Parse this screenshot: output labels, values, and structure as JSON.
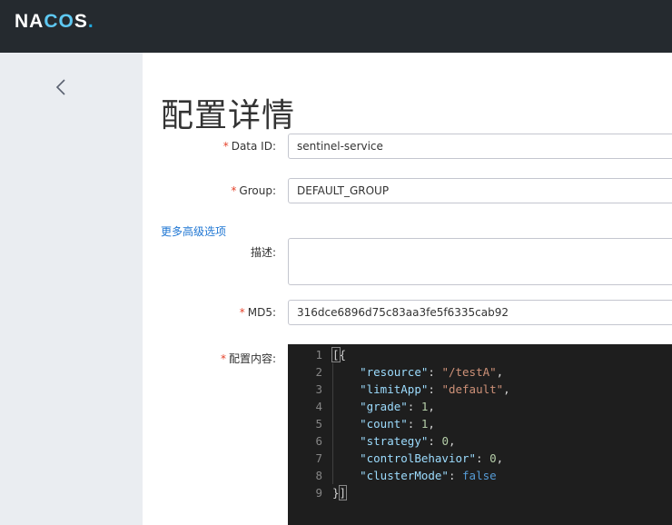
{
  "header": {
    "logo_text": "NACOS.",
    "accent": "#5ec8f2"
  },
  "sidebar": {
    "back_icon": "chevron-left-icon"
  },
  "page": {
    "title": "配置详情"
  },
  "form": {
    "data_id": {
      "required_mark": "*",
      "label": "Data ID:",
      "value": "sentinel-service"
    },
    "group": {
      "required_mark": "*",
      "label": "Group:",
      "value": "DEFAULT_GROUP"
    },
    "advanced_link": "更多高级选项",
    "description": {
      "label": "描述:",
      "value": ""
    },
    "md5": {
      "required_mark": "*",
      "label": "MD5:",
      "value": "316dce6896d75c83aa3fe5f6335cab92"
    },
    "content": {
      "required_mark": "*",
      "label": "配置内容:"
    }
  },
  "editor": {
    "line_numbers": [
      "1",
      "2",
      "3",
      "4",
      "5",
      "6",
      "7",
      "8",
      "9"
    ],
    "lines": [
      "[{",
      "    \"resource\": \"/testA\",",
      "    \"limitApp\": \"default\",",
      "    \"grade\": 1,",
      "    \"count\": 1,",
      "    \"strategy\": 0,",
      "    \"controlBehavior\": 0,",
      "    \"clusterMode\": false",
      "}]"
    ]
  }
}
